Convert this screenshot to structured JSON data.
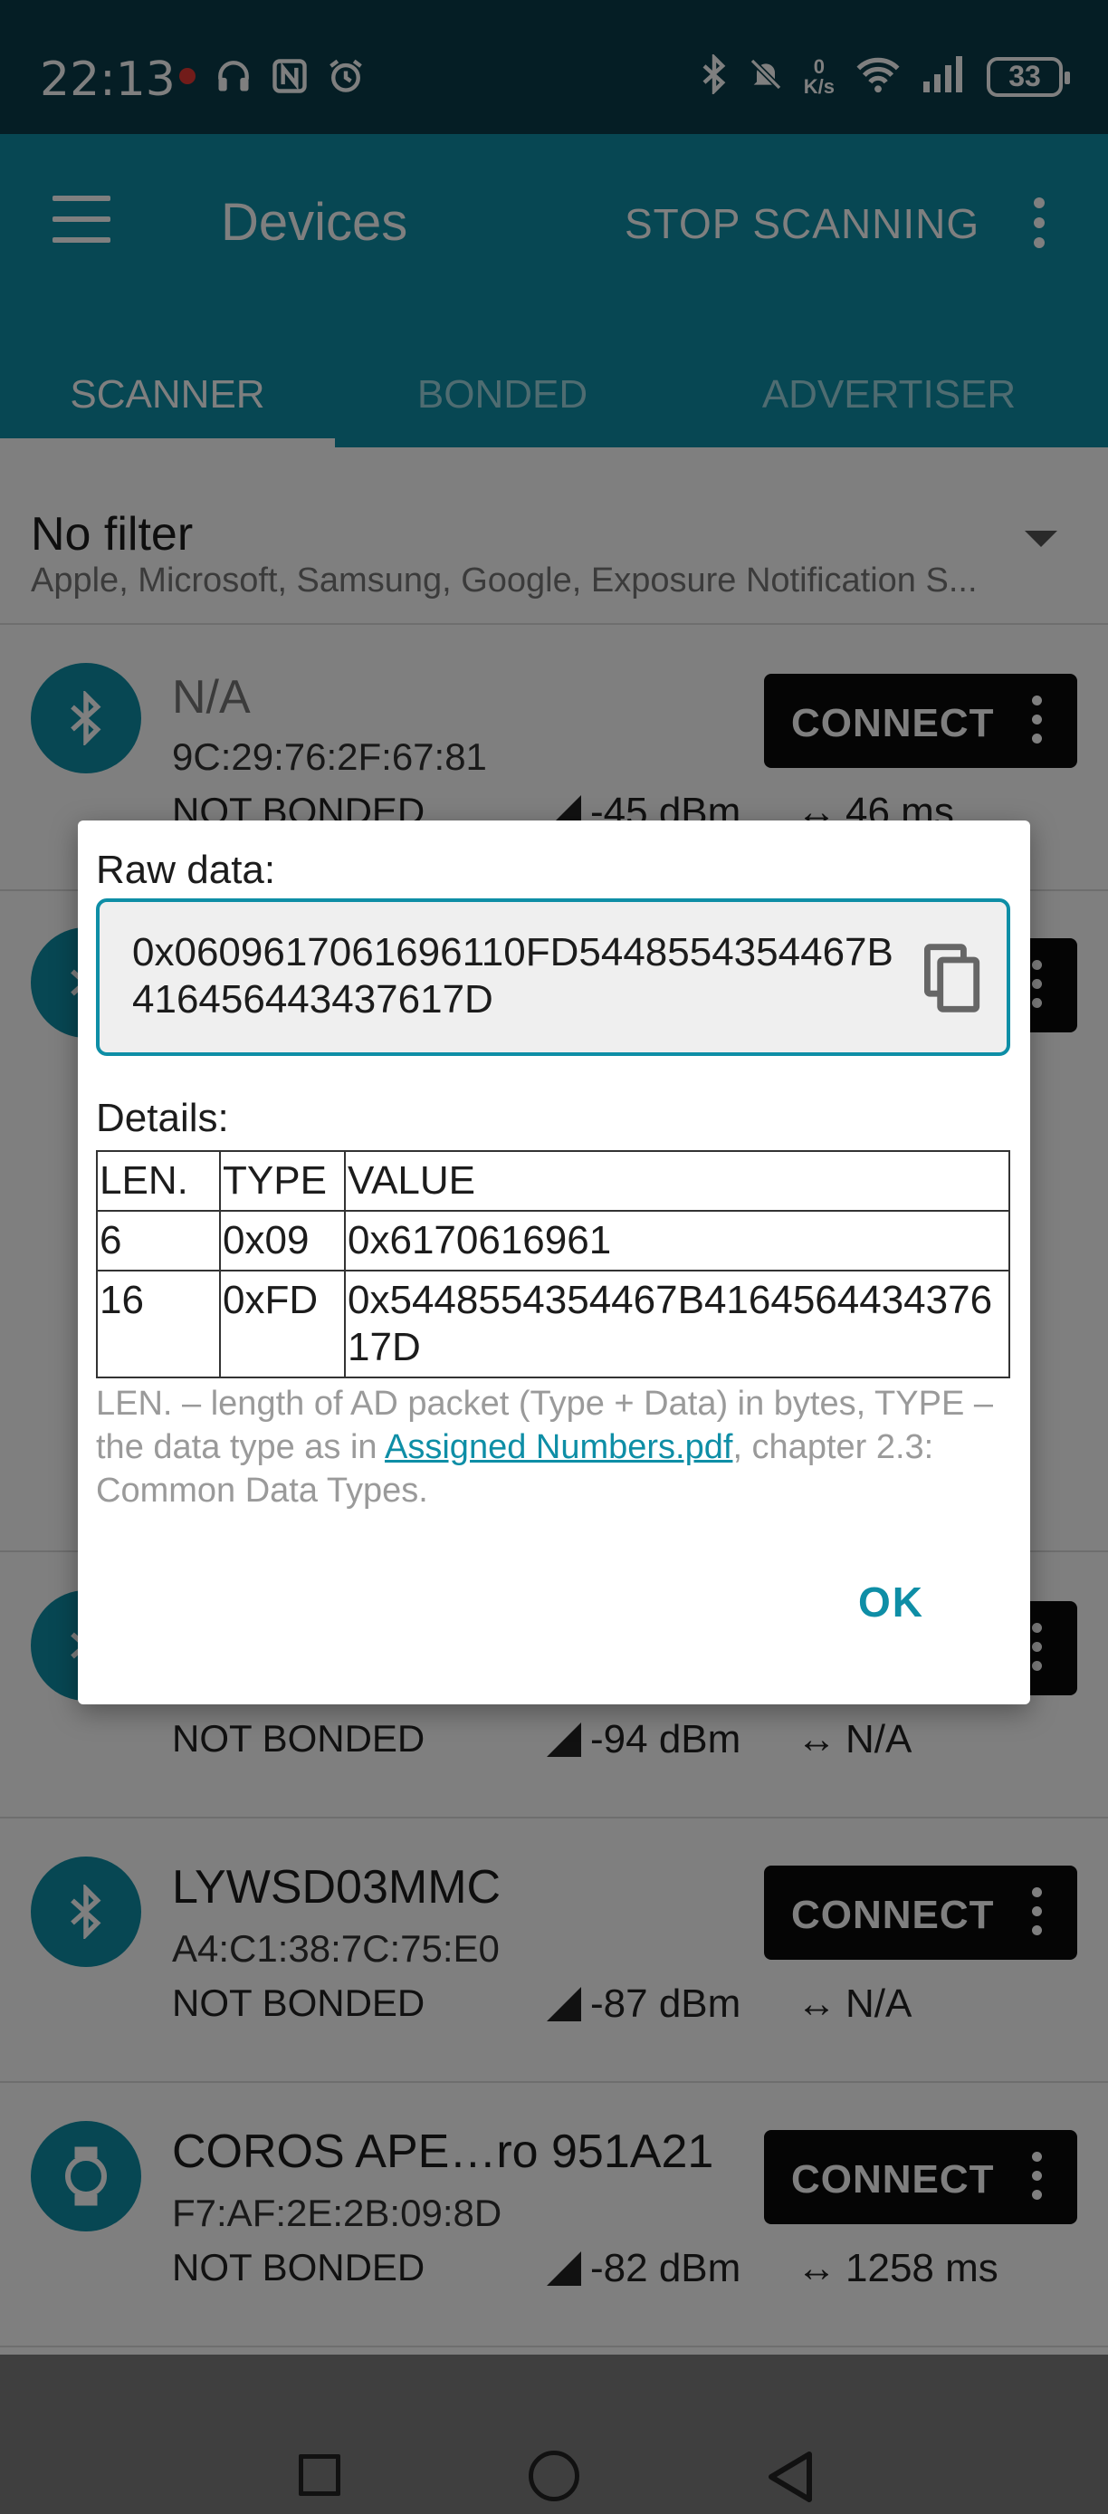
{
  "status_bar": {
    "time": "22:13",
    "netspeed_value": "0",
    "netspeed_unit": "K/s",
    "battery": "33",
    "icons": [
      "notification-dot-icon",
      "headphones-icon",
      "nfc-icon",
      "alarm-icon",
      "bluetooth-icon",
      "mute-icon",
      "wifi-icon",
      "cell-signal-icon",
      "battery-icon"
    ]
  },
  "app_bar": {
    "title": "Devices",
    "stop_scanning": "STOP SCANNING",
    "tabs": [
      "SCANNER",
      "BONDED",
      "ADVERTISER"
    ]
  },
  "filter": {
    "title": "No filter",
    "subtitle": "Apple, Microsoft, Samsung, Google, Exposure Notification S..."
  },
  "devices": [
    {
      "name": "N/A",
      "address": "9C:29:76:2F:67:81",
      "bond": "NOT BONDED",
      "rssi": "-45 dBm",
      "interval": "46 ms",
      "icon": "bluetooth-icon"
    },
    {
      "name": "",
      "address": "",
      "bond": "NOT BONDED",
      "rssi": "-94 dBm",
      "interval": "N/A",
      "icon": "bluetooth-icon"
    },
    {
      "name": "LYWSD03MMC",
      "address": "A4:C1:38:7C:75:E0",
      "bond": "NOT BONDED",
      "rssi": "-87 dBm",
      "interval": "N/A",
      "icon": "bluetooth-icon"
    },
    {
      "name": "COROS APE…ro 951A21",
      "address": "F7:AF:2E:2B:09:8D",
      "bond": "NOT BONDED",
      "rssi": "-82 dBm",
      "interval": "1258 ms",
      "icon": "watch-icon"
    }
  ],
  "connect_label": "CONNECT",
  "dialog": {
    "raw_label": "Raw data:",
    "raw_value": "0x0609617061696110FD5448554354467B416456443437617D",
    "details_label": "Details:",
    "table": {
      "headers": [
        "LEN.",
        "TYPE",
        "VALUE"
      ],
      "rows": [
        [
          "6",
          "0x09",
          "0x6170616961"
        ],
        [
          "16",
          "0xFD",
          "0x5448554354467B416456443437617D"
        ]
      ]
    },
    "note_part1": "LEN. – length of AD packet (Type + Data) in bytes, TYPE – the data type as in ",
    "note_link": "Assigned Numbers.pdf",
    "note_part2": ", chapter 2.3: Common Data Types.",
    "ok": "OK"
  }
}
